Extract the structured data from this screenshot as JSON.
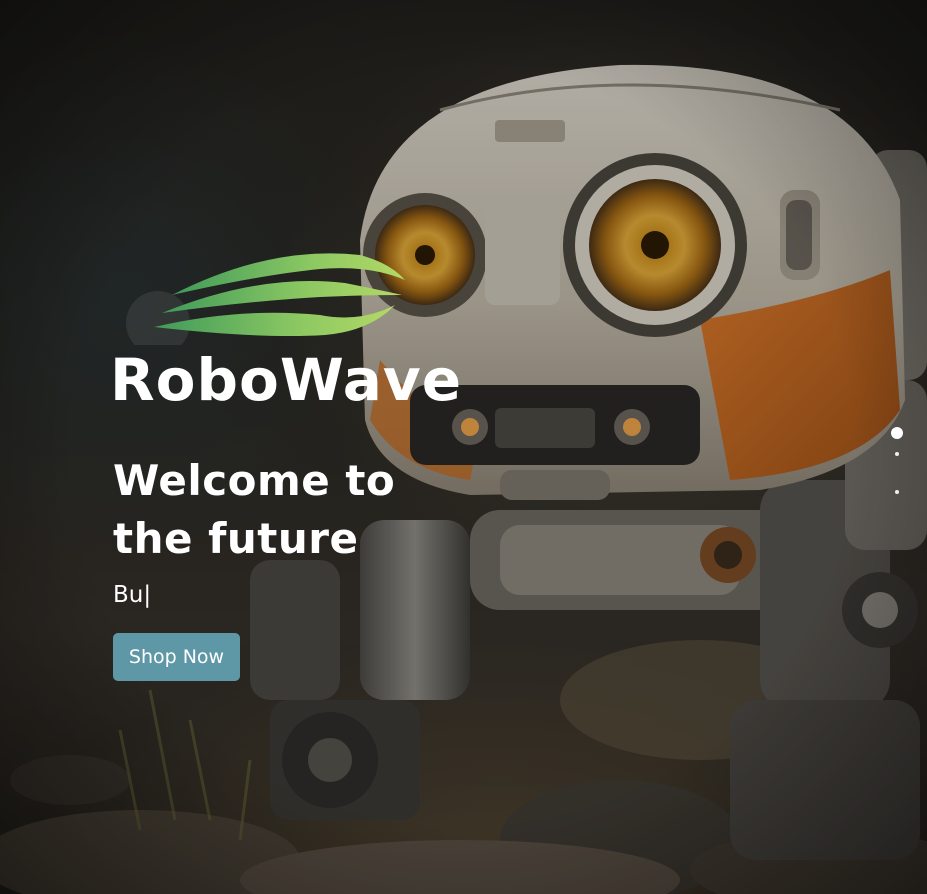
{
  "hero": {
    "brand_name": "RoboWave",
    "headline": "Welcome to the future",
    "typed_text": "Bu",
    "cursor": "|",
    "cta_label": "Shop Now"
  },
  "icons": {
    "logo": "wave-logo-icon",
    "slider_dots": [
      "active-dot",
      "dot",
      "dot"
    ]
  },
  "colors": {
    "cta_background": "#5e98a6",
    "logo_gradient_start": "#3f9a5a",
    "logo_gradient_end": "#b4d966",
    "text": "#ffffff"
  }
}
